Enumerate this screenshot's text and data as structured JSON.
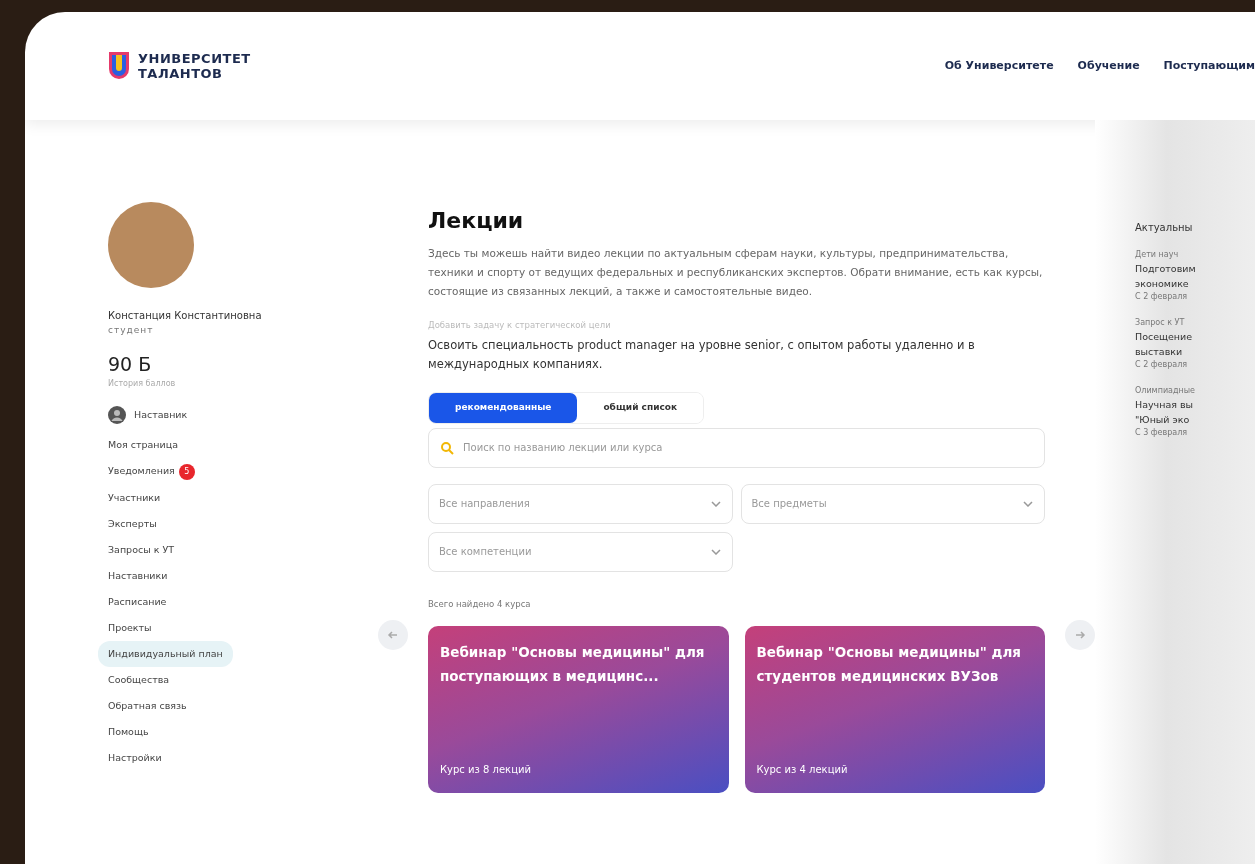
{
  "header": {
    "logo_lines": [
      "УНИВЕРСИТЕТ",
      "ТАЛАНТОВ"
    ],
    "nav": [
      {
        "label": "Об Университете"
      },
      {
        "label": "Обучение"
      },
      {
        "label": "Поступающим"
      }
    ]
  },
  "profile": {
    "name": "Констанция Константиновна",
    "role": "студент",
    "points": "90 Б",
    "points_link": "История баллов",
    "mentor": "Наставник"
  },
  "sidebar": {
    "items": [
      {
        "label": "Моя страница",
        "selected": false
      },
      {
        "label": "Уведомления",
        "selected": false,
        "badge": "5"
      },
      {
        "label": "Участники",
        "selected": false
      },
      {
        "label": "Эксперты",
        "selected": false
      },
      {
        "label": "Запросы к УТ",
        "selected": false
      },
      {
        "label": "Наставники",
        "selected": false
      },
      {
        "label": "Расписание",
        "selected": false
      },
      {
        "label": "Проекты",
        "selected": false
      },
      {
        "label": "Индивидуальный план",
        "selected": true
      },
      {
        "label": "Сообщества",
        "selected": false
      },
      {
        "label": "Обратная связь",
        "selected": false
      },
      {
        "label": "Помощь",
        "selected": false
      },
      {
        "label": "Настройки",
        "selected": false
      }
    ]
  },
  "main": {
    "title": "Лекции",
    "description": "Здесь ты можешь найти видео лекции по актуальным сферам науки, культуры, предпринимательства, техники и спорту от ведущих федеральных и республиканских экспертов. Обрати внимание, есть как курсы, состоящие из связанных лекций, а также и самостоятельные видео.",
    "goal_label": "Добавить задачу к стратегической цели",
    "goal": "Освоить специальность product manager на уровне senior, с опытом работы удаленно и в международных компаниях.",
    "tabs": [
      {
        "label": "рекомендованные",
        "selected": true
      },
      {
        "label": "общий список",
        "selected": false
      }
    ],
    "search": {
      "placeholder": "Поиск по названию лекции или курса"
    },
    "filters": [
      {
        "placeholder": "Все направления"
      },
      {
        "placeholder": "Все предметы"
      },
      {
        "placeholder": "Все компетенции"
      }
    ],
    "found": "Всего найдено 4 курса",
    "cards": [
      {
        "title": "Вебинар \"Основы медицины\" для поступающих в медицинс...",
        "meta": "Курс из 8 лекций"
      },
      {
        "title": "Вебинар \"Основы медицины\" для студентов медицинских ВУЗов",
        "meta": "Курс из 4 лекций"
      }
    ]
  },
  "aside": {
    "title": "Актуальны",
    "items": [
      {
        "category": "Дети науч",
        "lines": [
          "Подготовим",
          "экономике"
        ],
        "meta": "С 2 февраля"
      },
      {
        "category": "Запрос к УТ",
        "lines": [
          "Посещение",
          "выставки"
        ],
        "meta": "С 2 февраля"
      },
      {
        "category": "Олимпиадные",
        "lines": [
          "Научная вы",
          "\"Юный эко"
        ],
        "meta": "С 3 февраля"
      }
    ]
  }
}
